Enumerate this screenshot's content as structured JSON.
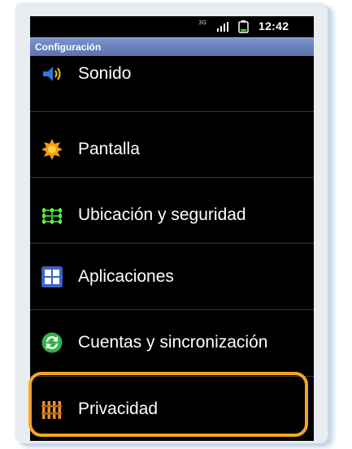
{
  "status_bar": {
    "network": "3G",
    "time": "12:42"
  },
  "title_bar": {
    "title": "Configuración"
  },
  "menu": {
    "items": [
      {
        "label": "Sonido",
        "icon": "speaker-icon"
      },
      {
        "label": "Pantalla",
        "icon": "brightness-icon"
      },
      {
        "label": "Ubicación y seguridad",
        "icon": "location-grid-icon"
      },
      {
        "label": "Aplicaciones",
        "icon": "apps-grid-icon"
      },
      {
        "label": "Cuentas y sincronización",
        "icon": "sync-icon"
      },
      {
        "label": "Privacidad",
        "icon": "privacy-fence-icon"
      }
    ]
  },
  "colors": {
    "title_bar": "#6a83bd",
    "highlight": "#f2a623",
    "sync_green": "#35b34a",
    "apps_blue": "#3d63c9"
  }
}
